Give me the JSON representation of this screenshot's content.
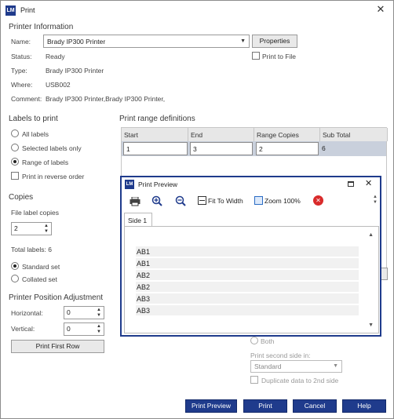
{
  "window": {
    "title": "Print",
    "logo": "LM"
  },
  "printer_info": {
    "section_title": "Printer Information",
    "name_label": "Name:",
    "name_value": "Brady IP300 Printer",
    "properties_button": "Properties",
    "print_to_file": "Print to File",
    "status_label": "Status:",
    "status_value": "Ready",
    "type_label": "Type:",
    "type_value": "Brady IP300 Printer",
    "where_label": "Where:",
    "where_value": "USB002",
    "comment_label": "Comment:",
    "comment_value": "Brady IP300 Printer,Brady IP300 Printer,"
  },
  "labels_to_print": {
    "section_title": "Labels to print",
    "options": [
      "All labels",
      "Selected labels only",
      "Range of labels"
    ],
    "selected": "Range of labels",
    "reverse": "Print in reverse order"
  },
  "copies": {
    "section_title": "Copies",
    "file_label_copies": "File label copies",
    "copies_value": "2",
    "total_labels": "Total labels: 6",
    "options": [
      "Standard set",
      "Collated set"
    ],
    "selected": "Standard set"
  },
  "position": {
    "section_title": "Printer Position Adjustment",
    "horizontal_label": "Horizontal:",
    "horizontal_value": "0",
    "vertical_label": "Vertical:",
    "vertical_value": "0",
    "print_first_row": "Print First Row"
  },
  "range": {
    "section_title": "Print range definitions",
    "headers": [
      "Start",
      "End",
      "Range Copies",
      "Sub Total"
    ],
    "row": [
      "1",
      "3",
      "2",
      "6"
    ]
  },
  "duplex": {
    "both": "Both",
    "second_side_label": "Print second side in:",
    "second_side_value": "Standard",
    "duplicate": "Duplicate data to 2nd side"
  },
  "preview": {
    "title": "Print Preview",
    "fit_to_width": "Fit To Width",
    "zoom": "Zoom 100%",
    "tab": "Side 1",
    "rows": [
      "AB1",
      "AB1",
      "AB2",
      "AB2",
      "AB3",
      "AB3"
    ]
  },
  "buttons": {
    "print_preview": "Print Preview",
    "print": "Print",
    "cancel": "Cancel",
    "help": "Help"
  },
  "colors": {
    "accent": "#1f3b8c",
    "close_red": "#d92b2b"
  }
}
